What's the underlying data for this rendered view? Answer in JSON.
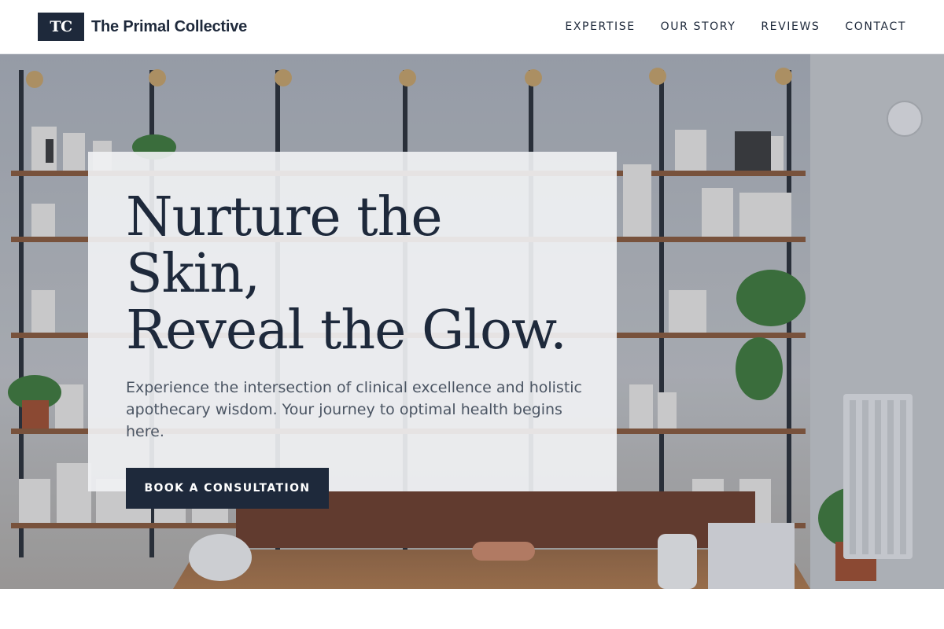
{
  "brand": {
    "logo_initials": "TC",
    "name": "The Primal Collective"
  },
  "nav": {
    "items": [
      {
        "label": "EXPERTISE"
      },
      {
        "label": "OUR STORY"
      },
      {
        "label": "REVIEWS"
      },
      {
        "label": "CONTACT"
      }
    ]
  },
  "hero": {
    "title_line1": "Nurture the Skin,",
    "title_line2": "Reveal the Glow.",
    "subtitle": "Experience the intersection of clinical excellence and holistic apothecary wisdom. Your journey to optimal health begins here.",
    "cta_label": "BOOK A CONSULTATION",
    "background_description_icon": "shop-interior-image"
  },
  "colors": {
    "primary": "#1e293b",
    "card_bg": "#f1f2f4",
    "subtitle_text": "#4b5563"
  }
}
